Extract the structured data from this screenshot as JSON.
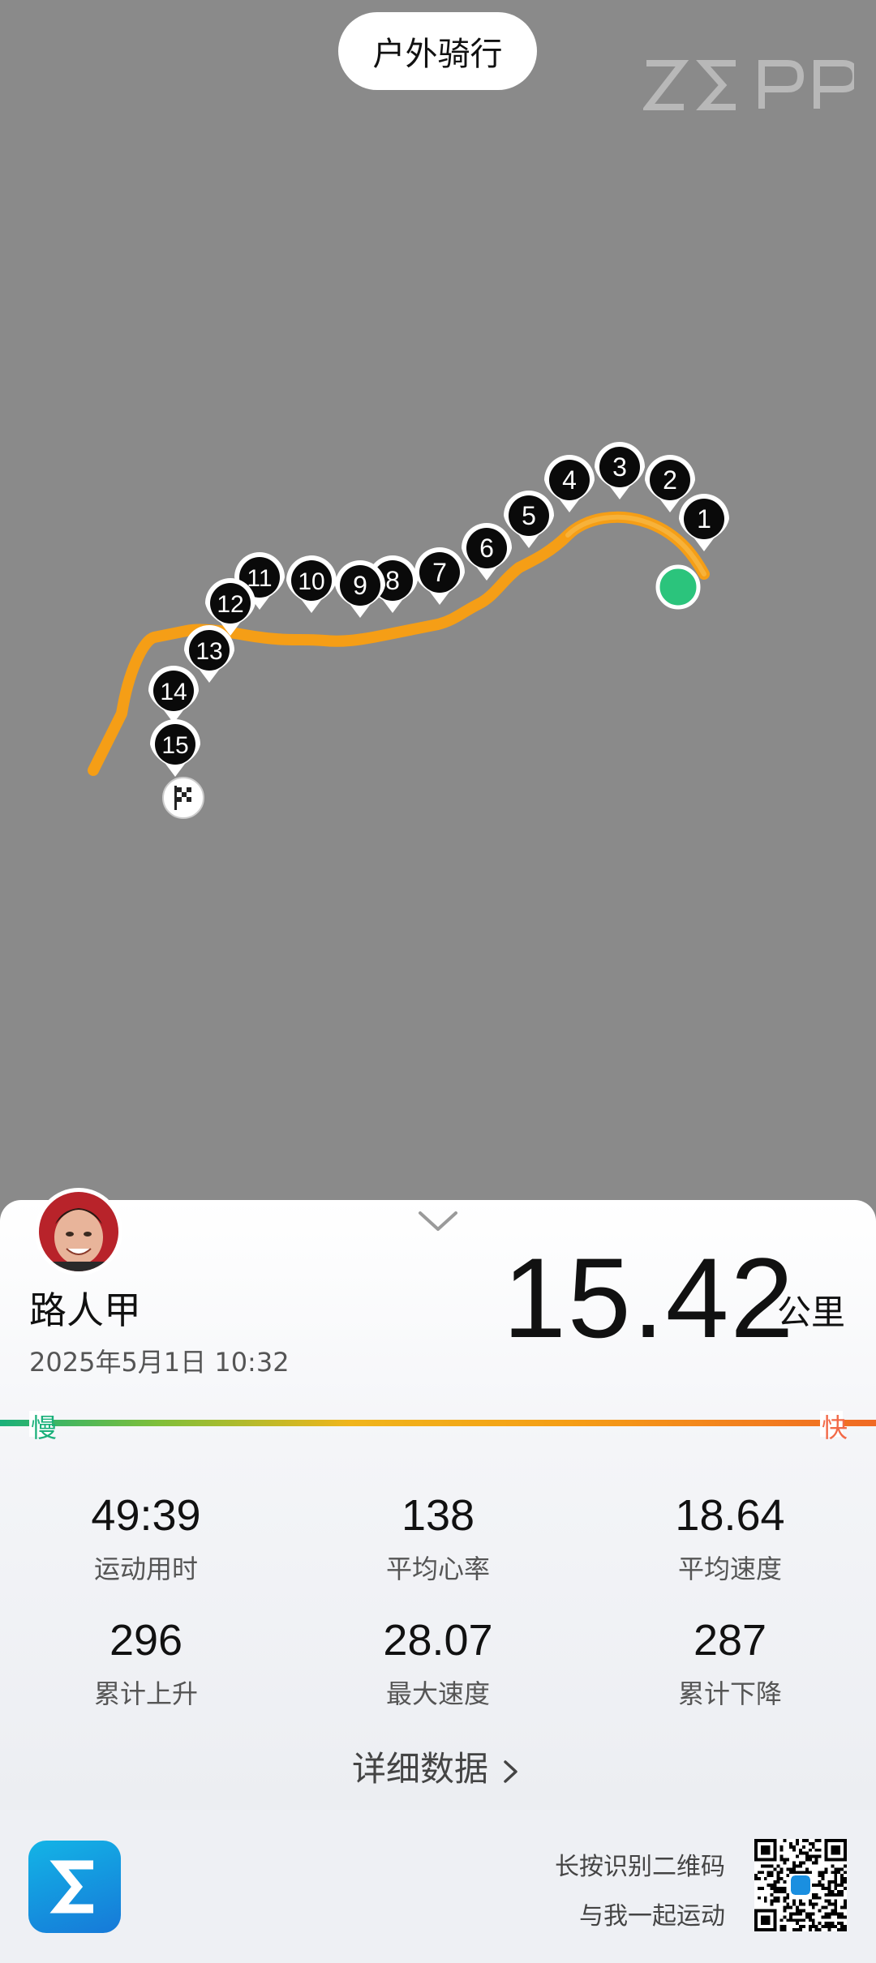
{
  "header": {
    "activity_type": "户外骑行",
    "brand": "ZEPP"
  },
  "map": {
    "route_color": "#f59e16",
    "start_color": "#2bc47c",
    "km_markers": [
      "1",
      "2",
      "3",
      "4",
      "5",
      "6",
      "7",
      "8",
      "9",
      "10",
      "11",
      "12",
      "13",
      "14",
      "15"
    ],
    "finish_icon": "checkered-flag-icon"
  },
  "profile": {
    "name": "路人甲",
    "datetime": "2025年5月1日 10:32",
    "avatar": "user-avatar"
  },
  "summary": {
    "distance": "15.42",
    "distance_unit": "公里"
  },
  "speed_legend": {
    "slow": "慢",
    "fast": "快"
  },
  "stats": [
    {
      "value": "49:39",
      "label": "运动用时"
    },
    {
      "value": "138",
      "label": "平均心率"
    },
    {
      "value": "18.64",
      "label": "平均速度"
    },
    {
      "value": "296",
      "label": "累计上升"
    },
    {
      "value": "28.07",
      "label": "最大速度"
    },
    {
      "value": "287",
      "label": "累计下降"
    }
  ],
  "details_link": "详细数据",
  "footer": {
    "hint_line1": "长按识别二维码",
    "hint_line2": "与我一起运动",
    "app_icon": "zepp-app-icon",
    "qr": "qr-code"
  }
}
